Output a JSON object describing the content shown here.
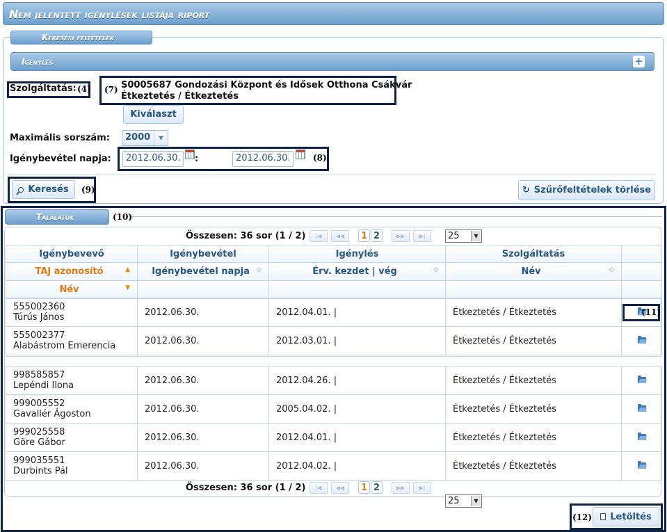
{
  "page_title": "Nem jelentett igénylések listája riport",
  "search": {
    "tab_label": "Keresési feltételek",
    "section_label": "Igénylés",
    "service_label": "Szolgáltatás:",
    "service_line1": "S0005687 Gondozási Központ és Idősek Otthona Csákvár",
    "service_line2": "Étkeztetés / Étkeztetés",
    "select_button": "Kiválaszt",
    "max_label": "Maximális sorszám:",
    "max_value": "2000",
    "date_label": "Igénybevétel napja:",
    "date_from": "2012.06.30.",
    "date_sep": ":",
    "date_to": "2012.06.30.",
    "search_button": "Keresés",
    "clear_button": "Szűrőfeltételek törlése"
  },
  "results": {
    "tab_label": "Találatok",
    "pager_text": "Összesen: 36 sor (1 / 2)",
    "pages": [
      "1",
      "2"
    ],
    "page_size": "25",
    "columns": {
      "group1": "Igénybevevő",
      "group2": "Igénybevétel",
      "group3": "Igénylés",
      "group4": "Szolgáltatás",
      "taj": "TAJ azonosító",
      "date": "Igénybevétel napja",
      "validity": "Érv. kezdet | vég",
      "name_service": "Név",
      "name": "Név"
    },
    "rows_top": [
      {
        "taj": "555002360",
        "name": "Túrús János",
        "date": "2012.06.30.",
        "validity": "2012.04.01. |",
        "service": "Étkeztetés / Étkeztetés"
      },
      {
        "taj": "555002377",
        "name": "Alabástrom Emerencia",
        "date": "2012.06.30.",
        "validity": "2012.03.01. |",
        "service": "Étkeztetés / Étkeztetés"
      }
    ],
    "rows_bottom": [
      {
        "taj": "998585857",
        "name": "Lepéndi Ilona",
        "date": "2012.06.30.",
        "validity": "2012.04.26. |",
        "service": "Étkeztetés / Étkeztetés"
      },
      {
        "taj": "999005552",
        "name": "Gavallér Ágoston",
        "date": "2012.06.30.",
        "validity": "2005.04.02. |",
        "service": "Étkeztetés / Étkeztetés"
      },
      {
        "taj": "999025558",
        "name": "Göre Gábor",
        "date": "2012.06.30.",
        "validity": "2012.04.01. |",
        "service": "Étkeztetés / Étkeztetés"
      },
      {
        "taj": "999035551",
        "name": "Durbints Pál",
        "date": "2012.06.30.",
        "validity": "2012.04.02. |",
        "service": "Étkeztetés / Étkeztetés"
      }
    ],
    "download_button": "Letöltés"
  },
  "callouts": {
    "c4": "(4)",
    "c7": "(7)",
    "c8": "(8)",
    "c9": "(9)",
    "c10": "(10)",
    "c11": "(11)",
    "c12": "(12)"
  },
  "icons": [
    "plus-icon",
    "dropdown-arrow-icon",
    "calendar-icon",
    "search-icon",
    "refresh-icon",
    "first-page-icon",
    "prev-page-icon",
    "next-page-icon",
    "last-page-icon",
    "sort-icon",
    "folder-open-icon",
    "document-icon"
  ]
}
